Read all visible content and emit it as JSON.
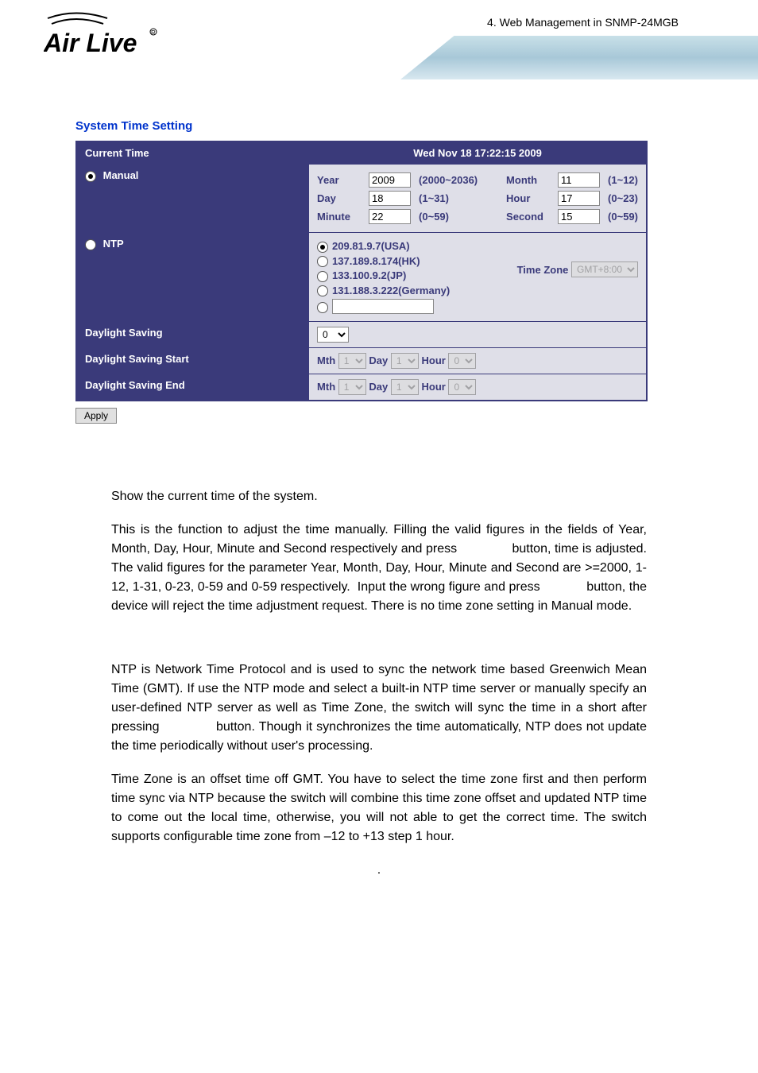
{
  "header": {
    "logo_top": "AirLive",
    "chapter": "4.  Web Management in SNMP-24MGB"
  },
  "title": "System Time Setting",
  "currentTime": {
    "label": "Current Time",
    "value": "Wed Nov 18 17:22:15 2009"
  },
  "manual": {
    "label": "Manual",
    "year": {
      "label": "Year",
      "value": "2009",
      "range": "(2000~2036)"
    },
    "month": {
      "label": "Month",
      "value": "11",
      "range": "(1~12)"
    },
    "day": {
      "label": "Day",
      "value": "18",
      "range": "(1~31)"
    },
    "hour": {
      "label": "Hour",
      "value": "17",
      "range": "(0~23)"
    },
    "minute": {
      "label": "Minute",
      "value": "22",
      "range": "(0~59)"
    },
    "second": {
      "label": "Second",
      "value": "15",
      "range": "(0~59)"
    }
  },
  "ntp": {
    "label": "NTP",
    "servers": [
      "209.81.9.7(USA)",
      "137.189.8.174(HK)",
      "133.100.9.2(JP)",
      "131.188.3.222(Germany)"
    ],
    "tz_label": "Time Zone",
    "tz_value": "GMT+8:00"
  },
  "daylight": {
    "label": "Daylight Saving",
    "value": "0",
    "start": {
      "label": "Daylight Saving Start",
      "mth": "Mth",
      "day": "Day",
      "hour": "Hour"
    },
    "end": {
      "label": "Daylight Saving End",
      "mth": "Mth",
      "day": "Day",
      "hour": "Hour"
    },
    "mv": "1",
    "dv": "1",
    "hv": "0"
  },
  "apply": "Apply",
  "body": {
    "p1": "Show the current time of the system.",
    "p2": "This is the function to adjust the time manually. Filling the valid figures in the fields of Year, Month, Day, Hour, Minute and Second respectively and press               button, time is adjusted. The valid figures for the parameter Year, Month, Day, Hour, Minute and Second are >=2000, 1-12, 1-31, 0-23, 0-59 and 0-59 respectively.  Input the wrong figure and press             button, the device will reject the time adjustment request. There is no time zone setting in Manual mode.",
    "p3": "NTP is Network Time Protocol and is used to sync the network time based Greenwich Mean Time (GMT). If use the NTP mode and select a built-in NTP time server or manually specify an user-defined NTP server as well as Time Zone, the switch will sync the time in a short after pressing              button. Though it synchronizes the time automatically, NTP does not update the time periodically without user's processing.",
    "p4": "Time Zone is an offset time off GMT. You have to select the time zone first and then perform time sync via NTP because the switch will combine this time zone offset and updated NTP time to come out the local time, otherwise, you will not able to get the correct time. The switch supports configurable time zone from –12 to +13 step 1 hour.",
    "p5": "."
  }
}
